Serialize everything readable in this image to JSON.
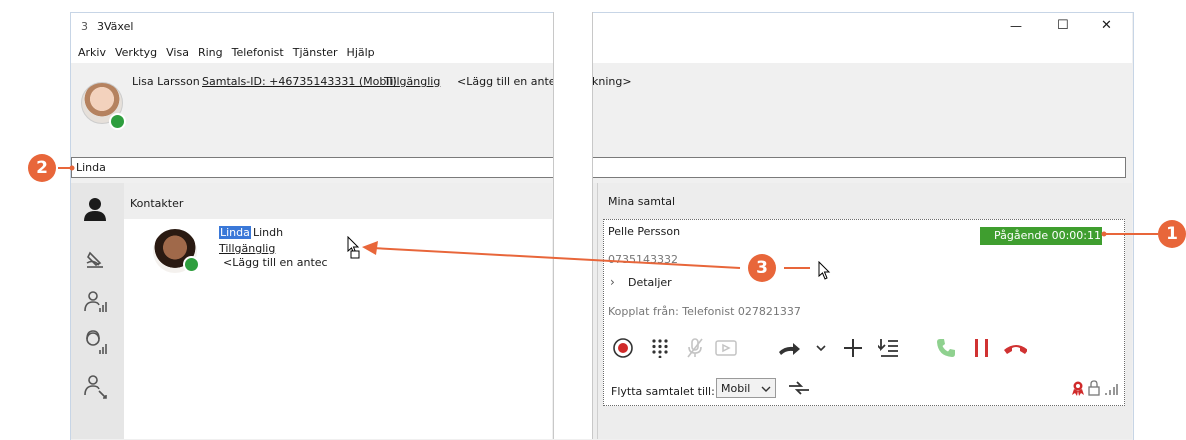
{
  "app": {
    "title": "3Växel",
    "logo_glyph": "3"
  },
  "menu": [
    "Arkiv",
    "Verktyg",
    "Visa",
    "Ring",
    "Telefonist",
    "Tjänster",
    "Hjälp"
  ],
  "user": {
    "name": "Lisa Larsson",
    "call_id": "Samtals-ID: +46735143331 (Mobil)",
    "status": "Tillgänglig",
    "note_left": "<Lägg till en antec",
    "note_right": "kning>",
    "presence_color": "#2e9e3e"
  },
  "search": {
    "value": "Linda"
  },
  "left_nav_icons": [
    "person-icon",
    "scribble-icon",
    "group-stats-icon",
    "headset-stats-icon",
    "group-transfer-icon"
  ],
  "contacts": {
    "header": "Kontakter",
    "items": [
      {
        "first_name_highlight": "Linda",
        "last_name": "Lindh",
        "status": "Tillgänglig",
        "note": "<Lägg till en antec"
      }
    ]
  },
  "calls": {
    "header": "Mina samtal",
    "card": {
      "caller": "Pelle Persson",
      "status_badge": "Pågående 00:00:11",
      "status_color": "#3f9e2f",
      "number": "0735143332",
      "details_label": "Detaljer",
      "connected_from": "Kopplat från: Telefonist 027821337",
      "move_label": "Flytta samtalet till:",
      "move_option": "Mobil"
    }
  },
  "annotations": {
    "badge1": "1",
    "badge2": "2",
    "badge3": "3",
    "color": "#e8663a"
  },
  "window_controls": {
    "minimize": "—",
    "maximize": "☐",
    "close": "✕"
  }
}
